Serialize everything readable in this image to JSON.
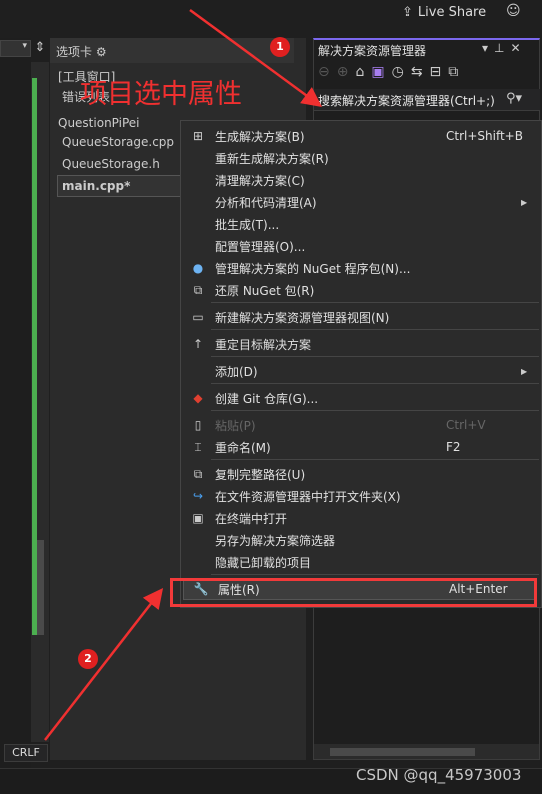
{
  "topbar": {
    "live_share": "Live Share",
    "live_share_icon": "share-icon",
    "feedback_icon": "feedback-icon"
  },
  "tabs_panel": {
    "title": "选项卡",
    "items": [
      "[工具窗口]",
      "错误列表",
      "QuestionPiPei",
      "QueueStorage.cpp",
      "QueueStorage.h",
      "main.cpp*"
    ]
  },
  "solution_explorer": {
    "title": "解决方案资源管理器",
    "search_placeholder": "搜索解决方案资源管理器(Ctrl+;)"
  },
  "context_menu": {
    "items": [
      {
        "icon": "build-icon",
        "label": "生成解决方案(B)",
        "shortcut": "Ctrl+Shift+B"
      },
      {
        "label": "重新生成解决方案(R)"
      },
      {
        "label": "清理解决方案(C)"
      },
      {
        "label": "分析和代码清理(A)",
        "submenu": true
      },
      {
        "label": "批生成(T)..."
      },
      {
        "label": "配置管理器(O)..."
      },
      {
        "icon": "nuget-icon",
        "label": "管理解决方案的 NuGet 程序包(N)..."
      },
      {
        "icon": "restore-icon",
        "label": "还原 NuGet 包(R)"
      },
      {
        "icon": "new-view-icon",
        "label": "新建解决方案资源管理器视图(N)"
      },
      {
        "icon": "arrow-up-icon",
        "label": "重定目标解决方案"
      },
      {
        "label": "添加(D)",
        "submenu": true
      },
      {
        "icon": "git-icon",
        "label": "创建 Git 仓库(G)..."
      },
      {
        "icon": "paste-icon",
        "label": "粘贴(P)",
        "shortcut": "Ctrl+V",
        "disabled": true
      },
      {
        "icon": "rename-icon",
        "label": "重命名(M)",
        "shortcut": "F2"
      },
      {
        "icon": "copy-icon",
        "label": "复制完整路径(U)"
      },
      {
        "icon": "open-folder-icon",
        "label": "在文件资源管理器中打开文件夹(X)"
      },
      {
        "icon": "terminal-icon",
        "label": "在终端中打开"
      },
      {
        "label": "另存为解决方案筛选器"
      },
      {
        "label": "隐藏已卸载的项目"
      },
      {
        "icon": "wrench-icon",
        "label": "属性(R)",
        "shortcut": "Alt+Enter",
        "selected": true
      }
    ]
  },
  "annotation": {
    "text": "项目选中属性",
    "badge1": "1",
    "badge2": "2",
    "color": "#f03030"
  },
  "status": {
    "line_ending": "CRLF"
  },
  "watermark": "CSDN @qq_45973003"
}
